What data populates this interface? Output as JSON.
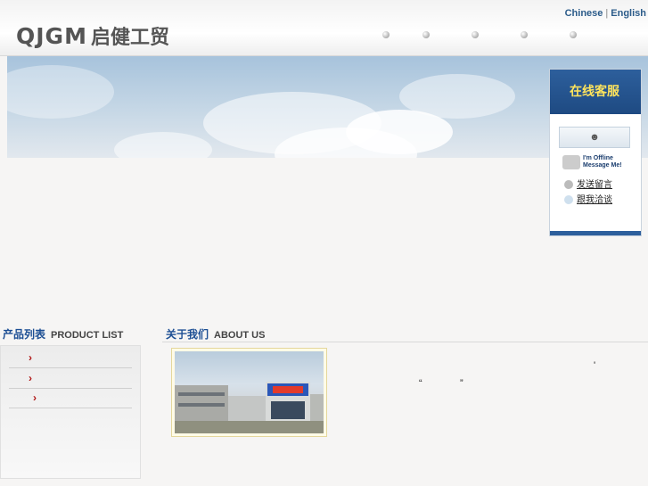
{
  "header": {
    "logo_latin": "QJGM",
    "logo_cn": "启健工贸",
    "lang_chinese": "Chinese",
    "lang_separator": "|",
    "lang_english": "English"
  },
  "service": {
    "title": "在线客服",
    "qq_icon": "user-icon",
    "offline_line1": "I'm Offline",
    "offline_line2": "Message Me!",
    "send_message": "发送留言",
    "chat_with_me": "跟我洽谈"
  },
  "product": {
    "title_cn": "产品列表",
    "title_en": "PRODUCT LIST",
    "items": [
      "",
      "",
      ""
    ]
  },
  "about": {
    "title_cn": "关于我们",
    "title_en": "ABOUT US",
    "text_comma": "'",
    "quote_open": "“",
    "quote_close": "”"
  },
  "colors": {
    "accent": "#1d4f94",
    "arrow": "#b01515",
    "service_head": "#2d5f9c",
    "service_title": "#ffe45c"
  }
}
